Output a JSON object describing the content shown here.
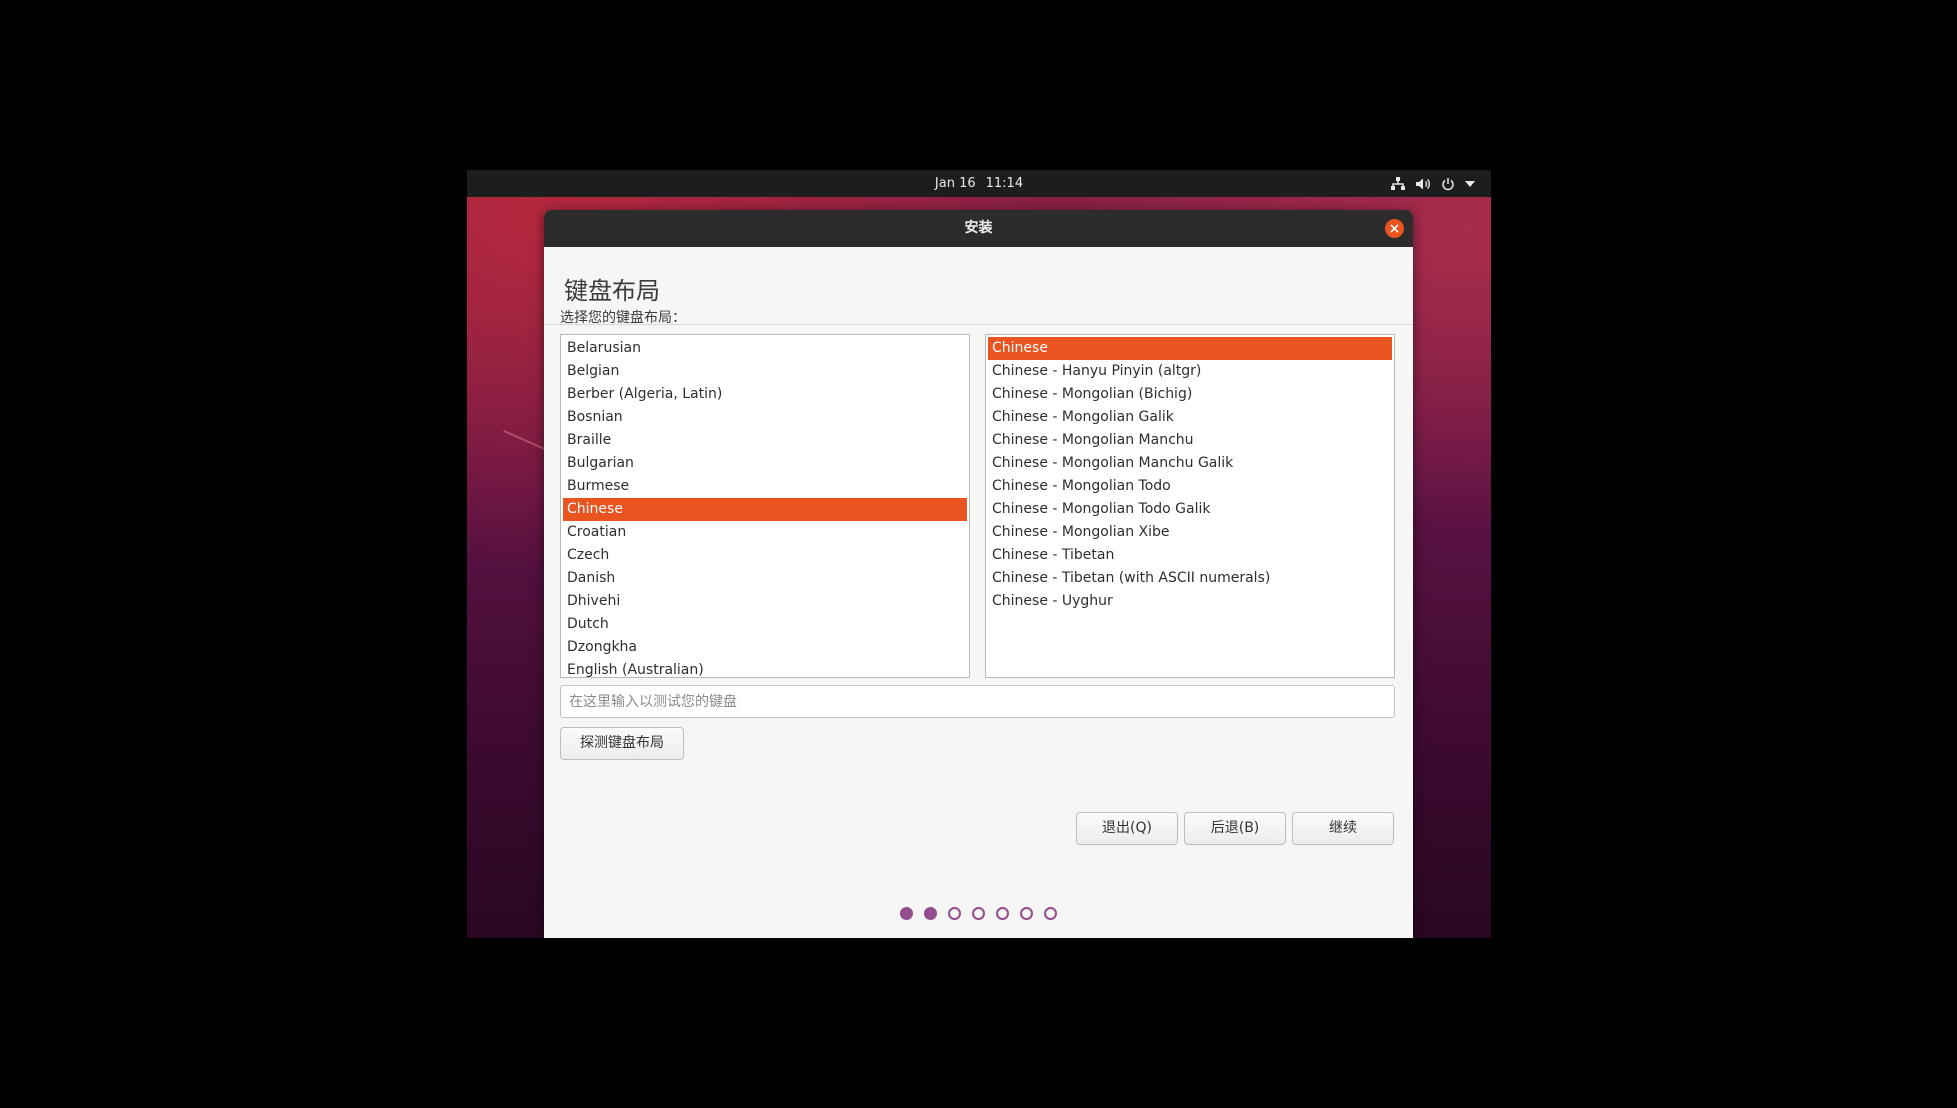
{
  "topbar": {
    "date": "Jan 16",
    "time": "11:14",
    "tray_icons": [
      "network-icon",
      "volume-icon",
      "power-icon",
      "chevron-down-icon"
    ]
  },
  "window": {
    "title": "安装",
    "page_title": "键盘布局",
    "prompt": "选择您的键盘布局："
  },
  "layouts": [
    "Belarusian",
    "Belgian",
    "Berber (Algeria, Latin)",
    "Bosnian",
    "Braille",
    "Bulgarian",
    "Burmese",
    "Chinese",
    "Croatian",
    "Czech",
    "Danish",
    "Dhivehi",
    "Dutch",
    "Dzongkha",
    "English (Australian)"
  ],
  "layouts_selected": "Chinese",
  "variants": [
    "Chinese",
    "Chinese - Hanyu Pinyin (altgr)",
    "Chinese - Mongolian (Bichig)",
    "Chinese - Mongolian Galik",
    "Chinese - Mongolian Manchu",
    "Chinese - Mongolian Manchu Galik",
    "Chinese - Mongolian Todo",
    "Chinese - Mongolian Todo Galik",
    "Chinese - Mongolian Xibe",
    "Chinese - Tibetan",
    "Chinese - Tibetan (with ASCII numerals)",
    "Chinese - Uyghur"
  ],
  "variants_selected": "Chinese",
  "test_input": {
    "value": "",
    "placeholder": "在这里输入以测试您的键盘"
  },
  "buttons": {
    "detect": "探测键盘布局",
    "quit": "退出(Q)",
    "back": "后退(B)",
    "continue": "继续"
  },
  "progress": {
    "total_steps": 7,
    "completed_steps": 2
  },
  "colors": {
    "accent": "#e95420",
    "step_dot": "#924d8b",
    "titlebar": "#2c2c2c"
  }
}
